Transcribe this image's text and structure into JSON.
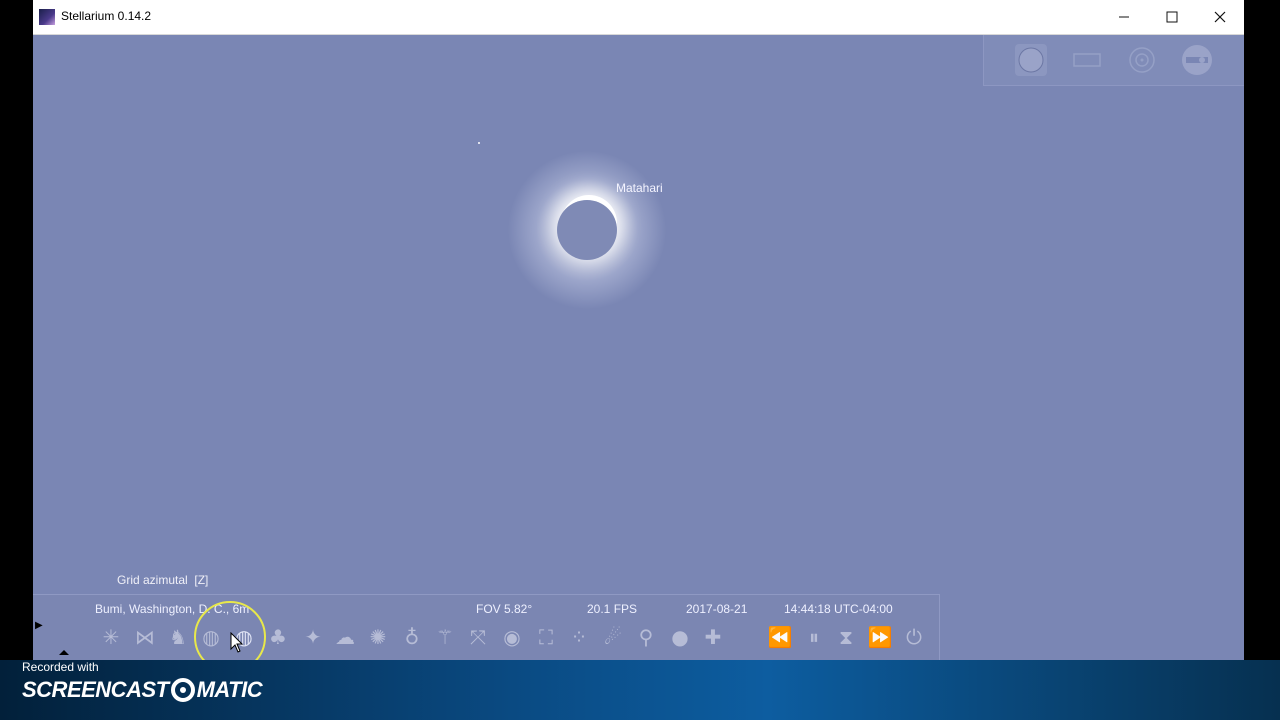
{
  "window": {
    "title": "Stellarium 0.14.2",
    "controls": {
      "minimize": "—",
      "maximize": "☐",
      "close": "✕"
    }
  },
  "sky": {
    "object_label": "Matahari",
    "background_color": "#7a86b4"
  },
  "top_right_panel": {
    "icons": [
      "circle-icon",
      "rectangle-icon",
      "target-icon",
      "eyepiece-icon"
    ]
  },
  "tooltip": "Grid azimutal  [Z]",
  "status_bar": {
    "location": "Bumi, Washington, D. C., 6m",
    "fov": "FOV 5.82°",
    "fps": "20.1 FPS",
    "date": "2017-08-21",
    "time": "14:44:18 UTC-04:00"
  },
  "toolbar": {
    "buttons": [
      {
        "name": "constellation-lines",
        "glyph": "✳"
      },
      {
        "name": "constellation-labels",
        "glyph": "⋈"
      },
      {
        "name": "constellation-art",
        "glyph": "♞"
      },
      {
        "name": "equatorial-grid",
        "glyph": "◍"
      },
      {
        "name": "azimuthal-grid",
        "glyph": "◍",
        "active": true
      },
      {
        "name": "ground",
        "glyph": "♣"
      },
      {
        "name": "cardinal-points",
        "glyph": "✦"
      },
      {
        "name": "atmosphere",
        "glyph": "☁"
      },
      {
        "name": "nebulae",
        "glyph": "✺"
      },
      {
        "name": "planet-labels",
        "glyph": "♁"
      },
      {
        "name": "equatorial-mount",
        "glyph": "⚚"
      },
      {
        "name": "center-selected",
        "glyph": "⤧"
      },
      {
        "name": "night-mode",
        "glyph": "◉"
      },
      {
        "name": "full-screen",
        "glyph": "⛶"
      },
      {
        "name": "exoplanets",
        "glyph": "⁘"
      },
      {
        "name": "meteor-showers",
        "glyph": "☄"
      },
      {
        "name": "satellites",
        "glyph": "⚲"
      },
      {
        "name": "solar-system-bodies",
        "glyph": "●"
      },
      {
        "name": "star-markers",
        "glyph": "✚"
      },
      {
        "name": "decrease-time-speed",
        "glyph": "⏪"
      },
      {
        "name": "pause-time",
        "glyph": "⏸"
      },
      {
        "name": "real-time-speed",
        "glyph": "⧗"
      },
      {
        "name": "increase-time-speed",
        "glyph": "⏩"
      },
      {
        "name": "quit",
        "glyph": "⏻"
      }
    ]
  },
  "recorder": {
    "label": "Recorded with",
    "brand_left": "SCREENCAST",
    "brand_right": "MATIC"
  }
}
